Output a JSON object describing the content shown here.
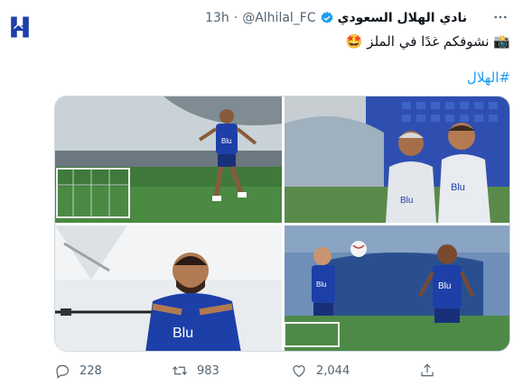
{
  "tweet": {
    "display_name": "نادي الهلال السعودي",
    "handle": "@Alhilal_FC",
    "separator": "·",
    "time": "13h",
    "text": "📸 نشوفكم غدًا في الملز 🤩",
    "hashtag": "#الهلال"
  },
  "media": {
    "photo_count": 4,
    "photos": [
      {
        "kind": "player-jogging-on-pitch"
      },
      {
        "kind": "coaches-smiling"
      },
      {
        "kind": "player-resistance-band-training"
      },
      {
        "kind": "players-warming-up-with-ball"
      }
    ],
    "jersey_text": "Blu",
    "jersey_color": "#1d3fa8"
  },
  "actions": {
    "reply_count": "228",
    "retweet_count": "983",
    "like_count": "2,044"
  },
  "icons": {
    "avatar": "alhilal-logo-icon",
    "verified": "verified-badge-icon",
    "more": "more-options-icon",
    "reply": "reply-icon",
    "retweet": "retweet-icon",
    "like": "heart-icon",
    "share": "share-icon"
  },
  "colors": {
    "accent": "#1d9bf0",
    "club_blue": "#1d3fa8",
    "muted_text": "#536471"
  }
}
